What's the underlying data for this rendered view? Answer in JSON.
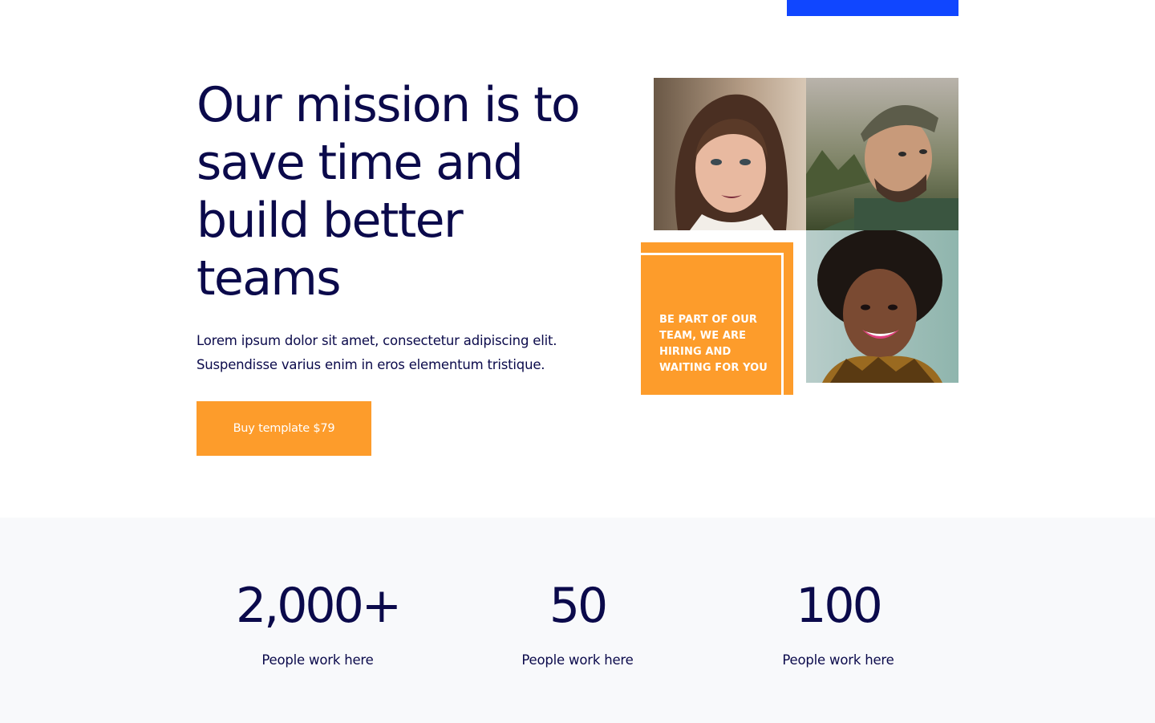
{
  "hero": {
    "title": "Our mission is to save time and build better teams",
    "text": "Lorem ipsum dolor sit amet, consectetur adipiscing elit. Suspendisse varius enim in eros elementum tristique.",
    "cta_label": "Buy template $79"
  },
  "hiring_card": {
    "text": "BE PART OF OUR TEAM, WE ARE HIRING AND WAITING FOR YOU"
  },
  "stats": [
    {
      "value": "2,000+",
      "label": "People work here"
    },
    {
      "value": "50",
      "label": "People work here"
    },
    {
      "value": "100",
      "label": "People work here"
    }
  ],
  "colors": {
    "accent_orange": "#fd9c2b",
    "accent_blue": "#1046ff",
    "text_navy": "#0b0a4b",
    "stats_background": "#f8f9fb"
  }
}
